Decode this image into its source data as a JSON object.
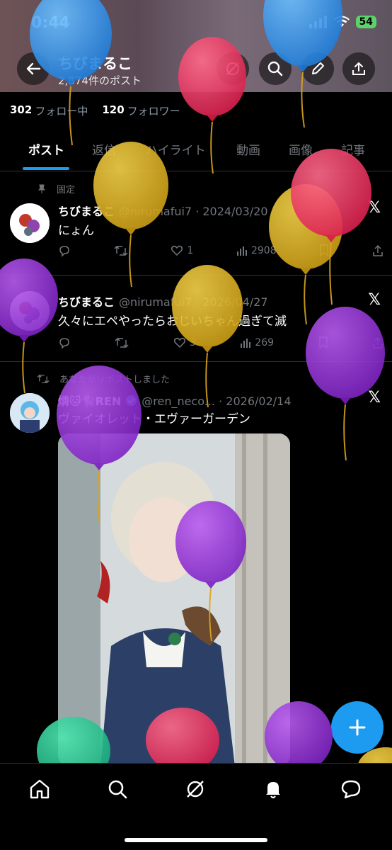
{
  "status_bar": {
    "time": "0:44",
    "battery": "54"
  },
  "header": {
    "title": "ちびまるこ",
    "subtitle": "2,874件のポスト"
  },
  "profile": {
    "following_count": "302",
    "following_label": "フォロー中",
    "followers_count": "120",
    "followers_label": "フォロワー"
  },
  "tabs": [
    "ポスト",
    "返信",
    "ハイライト",
    "動画",
    "画像",
    "記事"
  ],
  "posts": [
    {
      "note": "固定",
      "name": "ちびまるこ",
      "handle": "@nirumafui7",
      "date": "· 2024/03/20",
      "text": "にょん",
      "likes": "1",
      "views": "2908"
    },
    {
      "name": "ちびまるこ",
      "handle": "@nirumafui7",
      "date": "· 2026/04/27",
      "text": "久々にエペやったらおじいちゃん過ぎて滅",
      "likes": "3",
      "views": "269"
    },
    {
      "note": "あなたがリポストしました",
      "name": "燐🐱🐈‍⬛REN",
      "handle": "@ren_neco...",
      "date": "· 2026/02/14",
      "text": "ヴァイオレット・エヴァーガーデン"
    }
  ],
  "colors": {
    "accent": "#1d9bf0",
    "background": "#000000",
    "muted": "#71767b"
  },
  "icons": [
    "back-icon",
    "grok-icon",
    "search-icon",
    "edit-icon",
    "share-icon",
    "pin-icon",
    "repost-icon",
    "reply-icon",
    "like-icon",
    "views-icon",
    "bookmark-icon",
    "verified-icon",
    "x-logo-icon",
    "plus-icon",
    "home-icon",
    "bell-icon",
    "messages-icon"
  ]
}
